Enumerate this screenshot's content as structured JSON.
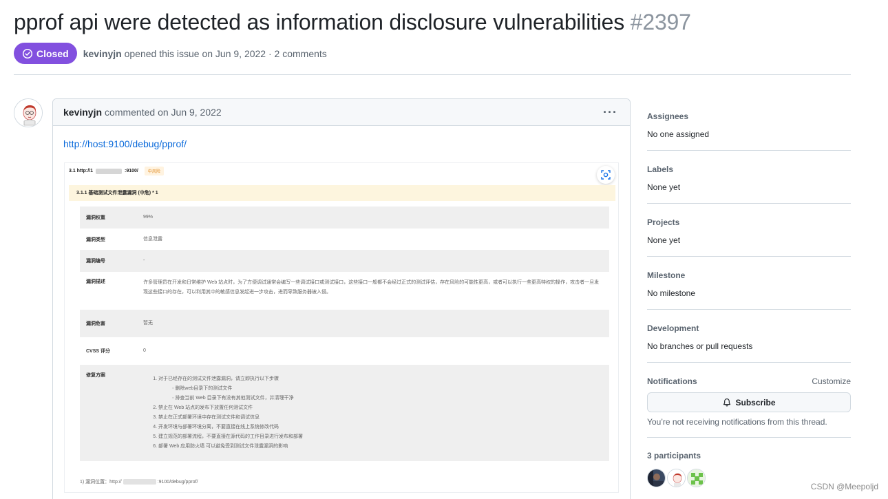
{
  "issue": {
    "title": "pprof api were detected as information disclosure vulnerabilities",
    "number": "#2397",
    "state": "Closed",
    "author": "kevinyjn",
    "meta_suffix": "opened this issue on Jun 9, 2022 · 2 comments",
    "state_color": "#8250df"
  },
  "comment": {
    "author": "kevinyjn",
    "action": "commented on Jun 9, 2022",
    "menu_icon": "kebab-horizontal-icon",
    "link_text": "http://host:9100/debug/pprof/",
    "report": {
      "heading_prefix": "3.1 http://1",
      "heading_suffix": ":9100/",
      "risk_tag": "中风险",
      "subheading": "3.1.1 基础测试文件泄露漏洞 (中危) * 1",
      "rows": [
        {
          "key": "漏洞权重",
          "value": "99%"
        },
        {
          "key": "漏洞类型",
          "value": "信息泄露"
        },
        {
          "key": "漏洞编号",
          "value": "-"
        },
        {
          "key": "漏洞描述",
          "value": "许多管理员在开发和日常维护 Web 站点时，为了方便调试通常会编写一些调试接口或测试接口，这些接口一般都不会经过正式的测试评估，存在风险的可能性更高，或者可以执行一些更高特权的操作，攻击者一旦发现这些接口的存在，可以利用其中的敏感信息发起进一步攻击，进而导致服务器被入侵。"
        },
        {
          "key": "漏洞危害",
          "value": "暂无"
        },
        {
          "key": "CVSS 评分",
          "value": "0"
        }
      ],
      "fix": {
        "key": "修复方案",
        "items": [
          "对于已经存在的测试文件泄露漏洞，请立即执行以下步骤",
          "禁止在 Web 站点的发布下放置任何测试文件",
          "禁止在正式部署环境中存在测试文件和调试信息",
          "开发环境与部署环境分离，不要直接在线上系统修改代码",
          "建立规范的部署流程，不要直接在源代码的工作目录进行发布和部署",
          "部署 Web 应用防火墙 可以避免受到测试文件泄露漏洞的影响"
        ],
        "subitems": [
          "删除web目录下的测试文件",
          "排查当前 Web 目录下有没有其他测试文件，并清理干净"
        ]
      },
      "footer_prefix": "1) 漏洞位置：http://",
      "footer_suffix": ":9100/debug/pprof/"
    }
  },
  "sidebar": {
    "assignees": {
      "heading": "Assignees",
      "value": "No one assigned"
    },
    "labels": {
      "heading": "Labels",
      "value": "None yet"
    },
    "projects": {
      "heading": "Projects",
      "value": "None yet"
    },
    "milestone": {
      "heading": "Milestone",
      "value": "No milestone"
    },
    "development": {
      "heading": "Development",
      "value": "No branches or pull requests"
    },
    "notifications": {
      "heading": "Notifications",
      "customize": "Customize",
      "subscribe": "Subscribe",
      "text": "You’re not receiving notifications from this thread."
    },
    "participants": {
      "heading": "3 participants"
    }
  },
  "watermark": "CSDN @Meepoljd"
}
